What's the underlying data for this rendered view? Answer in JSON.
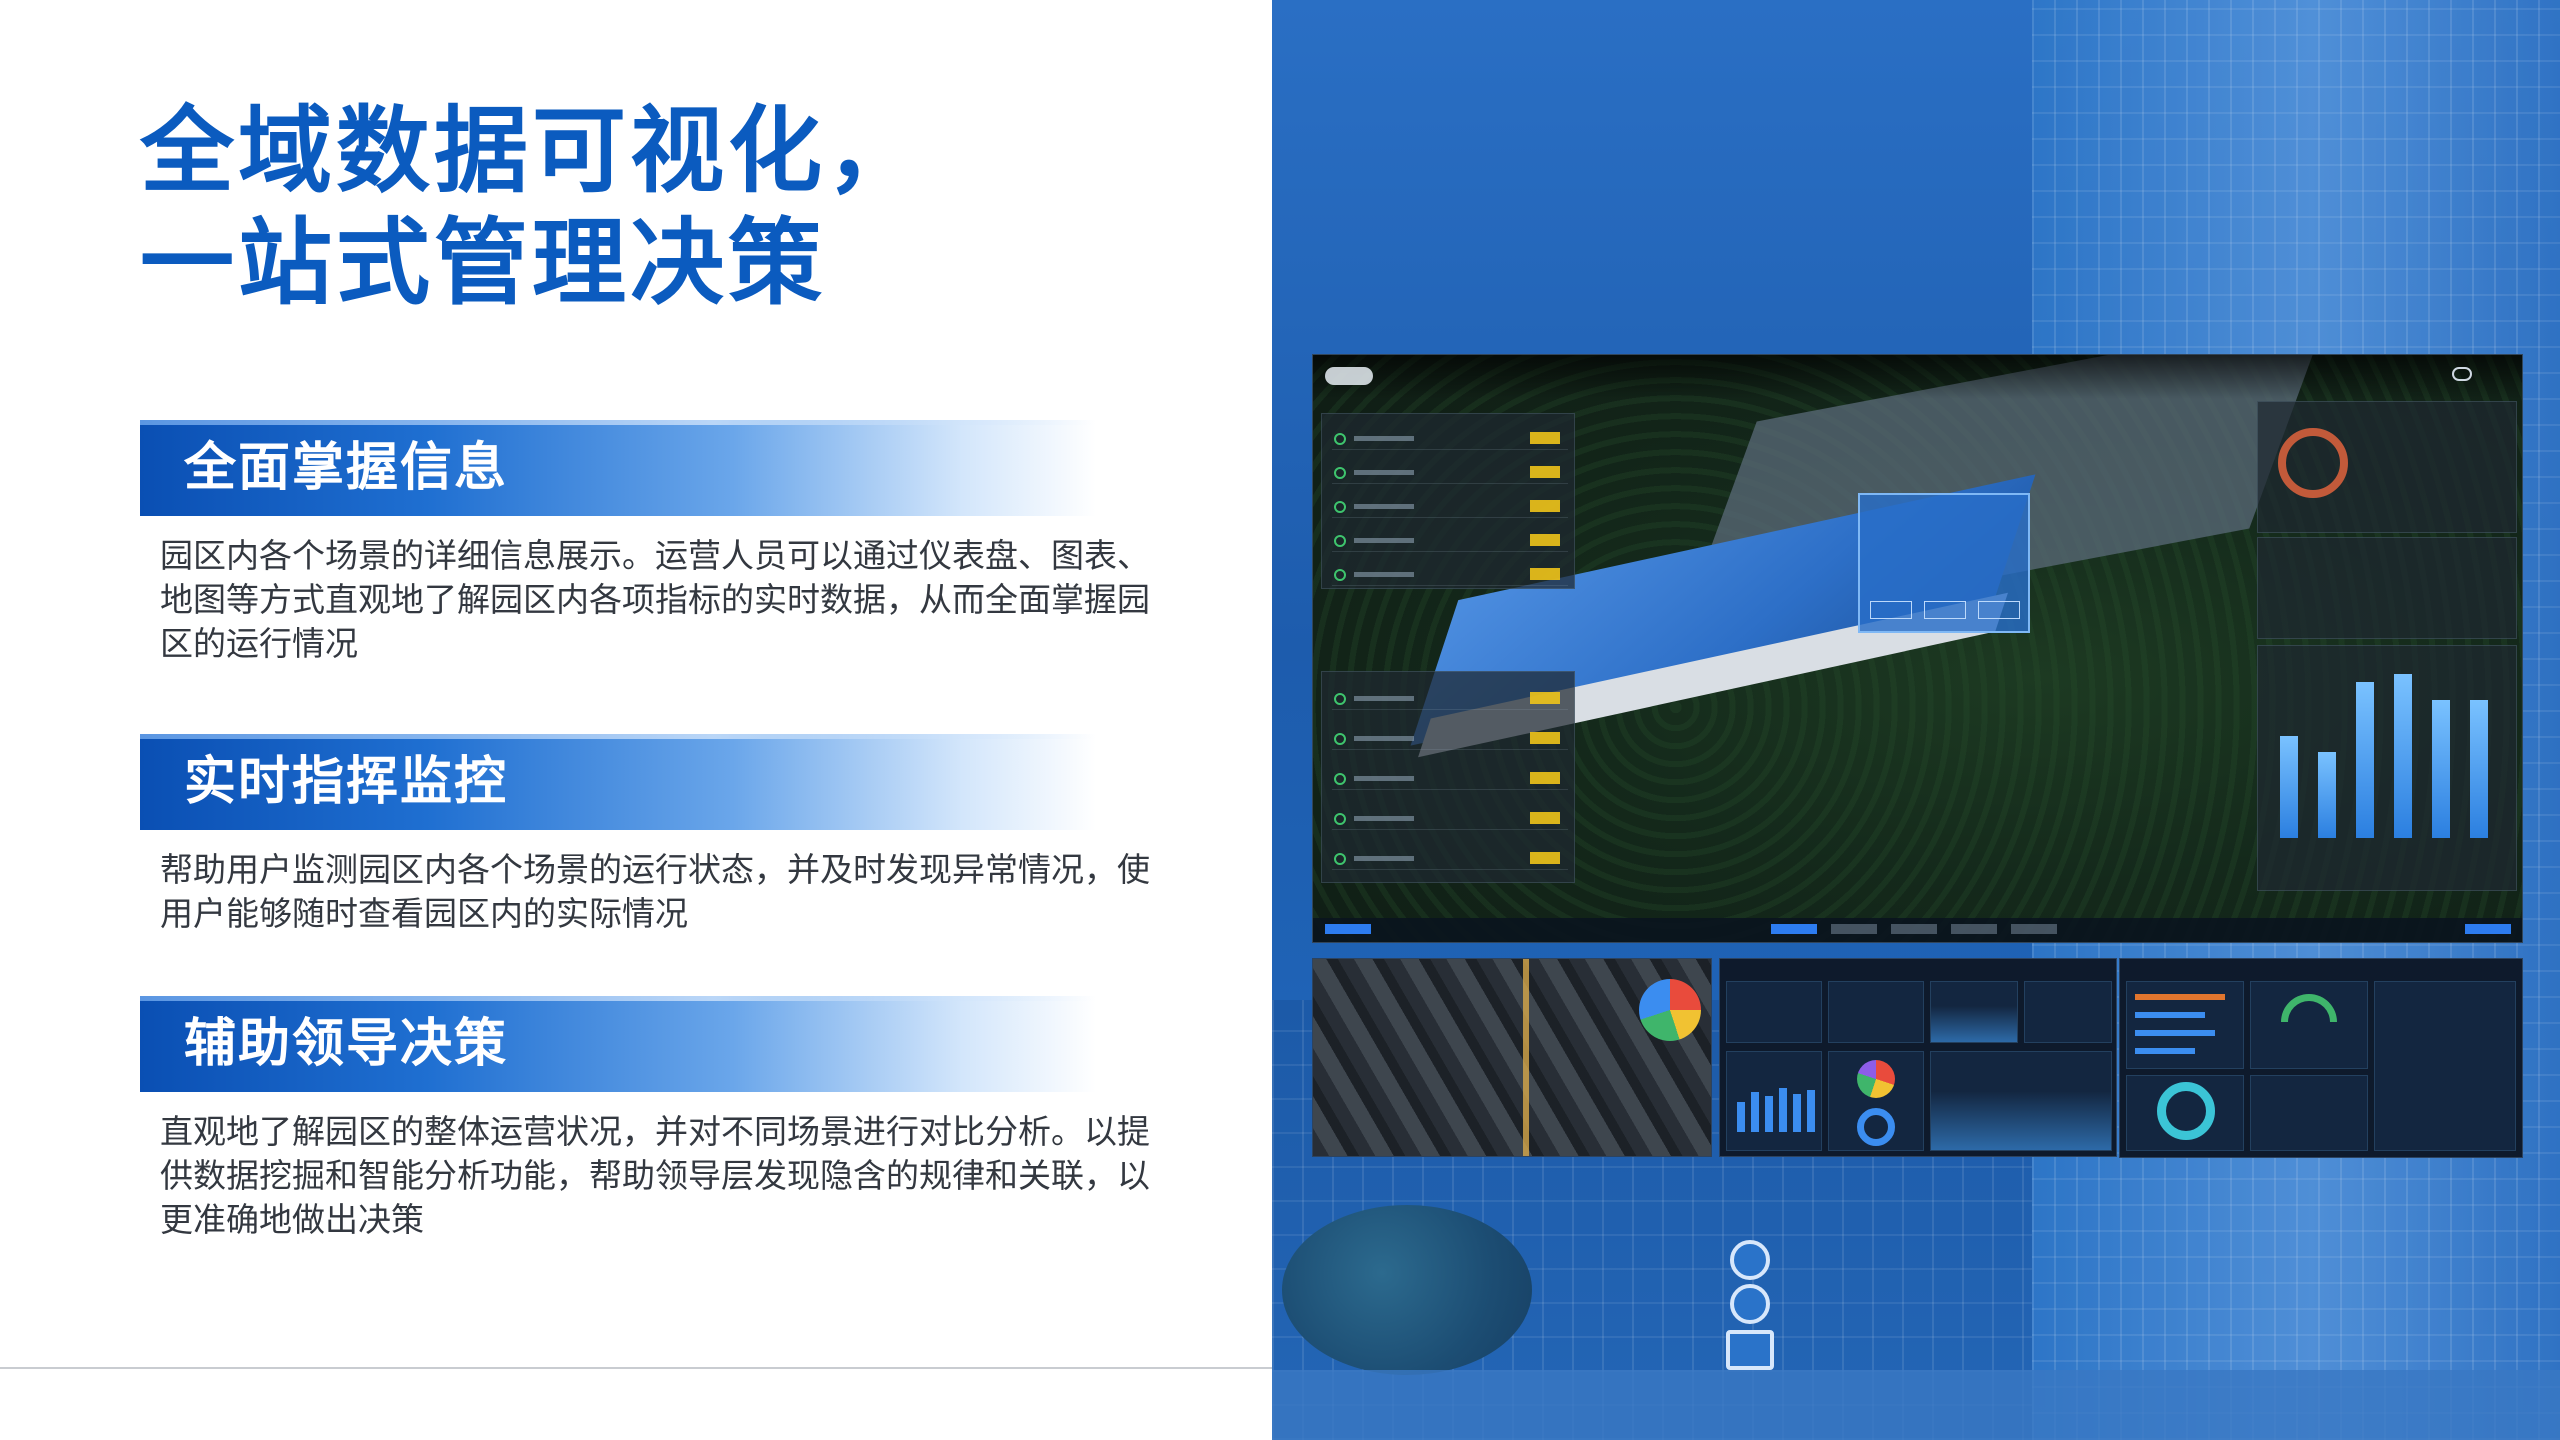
{
  "title": {
    "line1": "全域数据可视化，",
    "line2": "一站式管理决策"
  },
  "sections": [
    {
      "heading": "全面掌握信息",
      "body": "园区内各个场景的详细信息展示。运营人员可以通过仪表盘、图表、地图等方式直观地了解园区内各项指标的实时数据，从而全面掌握园区的运行情况"
    },
    {
      "heading": "实时指挥监控",
      "body": "帮助用户监测园区内各个场景的运行状态，并及时发现异常情况，使用户能够随时查看园区内的实际情况"
    },
    {
      "heading": "辅助领导决策",
      "body": "直观地了解园区的整体运营状况，并对不同场景进行对比分析。以提供数据挖掘和智能分析功能，帮助领导层发现隐含的规律和关联，以更准确地做出决策"
    }
  ],
  "colors": {
    "brand_blue": "#0b5bbf",
    "body_text": "#333840",
    "panel_blue": "#1d5cad"
  },
  "images": {
    "background": "glass-tower-building-photo",
    "main_dashboard": "aerial-campus-3d-dashboard-screenshot",
    "thumbnails": [
      "city-3d-map-dashboard",
      "analytics-charts-dashboard",
      "monitoring-gauges-dashboard"
    ]
  }
}
